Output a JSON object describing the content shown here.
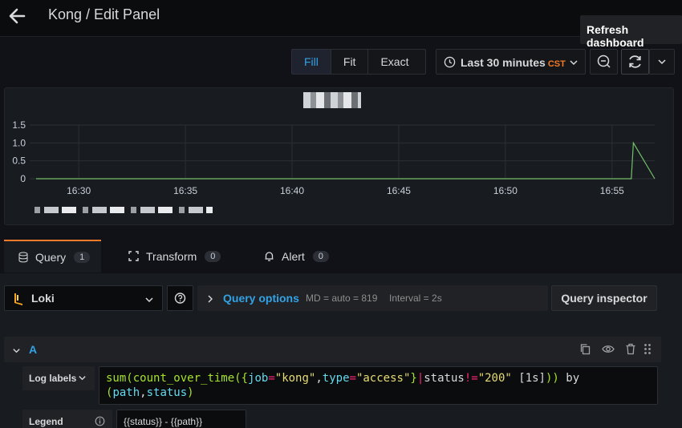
{
  "header": {
    "title": "Kong / Edit Panel",
    "tooltip": "Refresh dashboard"
  },
  "toolbar": {
    "view_modes": [
      "Fill",
      "Fit",
      "Exact"
    ],
    "active_view_mode": "Fill",
    "time_range": "Last 30 minutes",
    "timezone": "CST"
  },
  "chart_data": {
    "type": "line",
    "x": [
      "16:28",
      "16:29",
      "16:30",
      "16:31",
      "16:32",
      "16:33",
      "16:34",
      "16:35",
      "16:36",
      "16:37",
      "16:38",
      "16:39",
      "16:40",
      "16:41",
      "16:42",
      "16:43",
      "16:44",
      "16:45",
      "16:46",
      "16:47",
      "16:48",
      "16:49",
      "16:50",
      "16:51",
      "16:52",
      "16:53",
      "16:54",
      "16:55",
      "16:55.9",
      "16:56",
      "16:57"
    ],
    "series": [
      {
        "color": "#73bf69",
        "values": [
          0,
          0,
          0,
          0,
          0,
          0,
          0,
          0,
          0,
          0,
          0,
          0,
          0,
          0,
          0,
          0,
          0,
          0,
          0,
          0,
          0,
          0,
          0,
          0,
          0,
          0,
          0,
          0,
          0,
          1,
          0
        ]
      }
    ],
    "xticks": [
      "16:30",
      "16:35",
      "16:40",
      "16:45",
      "16:50",
      "16:55"
    ],
    "yticks": [
      "0",
      "0.5",
      "1.0",
      "1.5"
    ],
    "ylim": [
      0,
      1.5
    ],
    "grid": true,
    "legend": "bottom"
  },
  "query_tabs": [
    {
      "label": "Query",
      "count": "1"
    },
    {
      "label": "Transform",
      "count": "0"
    },
    {
      "label": "Alert",
      "count": "0"
    }
  ],
  "query": {
    "datasource": "Loki",
    "options_label": "Query options",
    "md": "MD = auto = 819",
    "interval": "Interval = 2s",
    "inspector_label": "Query inspector",
    "ref_id": "A",
    "log_labels_label": "Log labels",
    "legend_label": "Legend",
    "legend_value": "{{status}} - {{path}}"
  }
}
